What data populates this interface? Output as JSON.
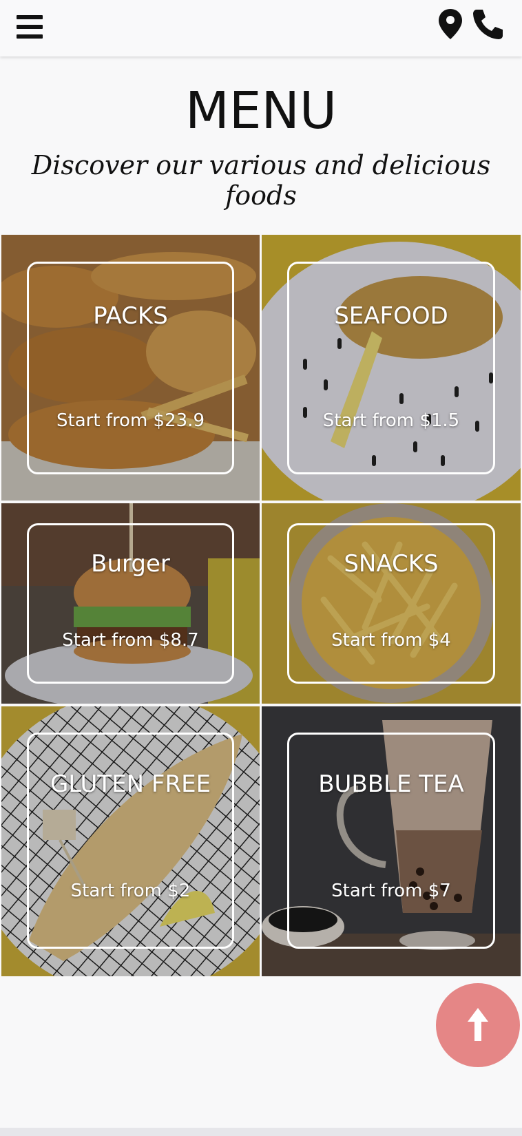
{
  "header": {
    "menu_icon": "hamburger-menu-icon",
    "location_icon": "map-pin-icon",
    "phone_icon": "phone-icon"
  },
  "page": {
    "title": "MENU",
    "subtitle": "Discover our various and delicious foods"
  },
  "categories": [
    {
      "name": "PACKS",
      "price": "Start from $23.9"
    },
    {
      "name": "SEAFOOD",
      "price": "Start from $1.5"
    },
    {
      "name": "Burger",
      "price": "Start from $8.7"
    },
    {
      "name": "SNACKS",
      "price": "Start from $4"
    },
    {
      "name": "GLUTEN FREE",
      "price": "Start from $2"
    },
    {
      "name": "BUBBLE TEA",
      "price": "Start from $7"
    }
  ],
  "scroll_top": {
    "icon": "arrow-up-icon",
    "color": "#e58686"
  }
}
